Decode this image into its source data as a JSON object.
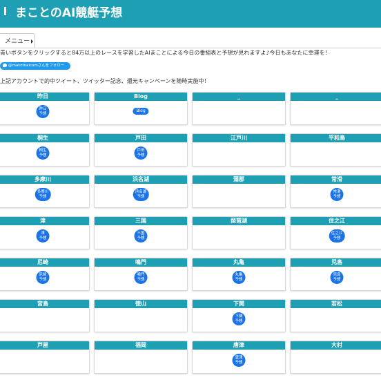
{
  "header": {
    "title": "まことのAI競艇予想"
  },
  "menu": {
    "label": "メニュー"
  },
  "intro_text": "青いボタンをクリックすると84万以上のレースを学習したAIまことによる今日の番組表と予想が見れますよ♪今日もあなたに幸運を！",
  "follow_button": "@makotoaicomさんをフォロー",
  "notice": "上記アカウントで的中ツイート、ツイッター記念、還元キャンペーンを随時実施中！",
  "cards": [
    {
      "name": "昨日",
      "button": [
        "昨日",
        "予想"
      ]
    },
    {
      "name": "Blog",
      "button": [
        "Blog"
      ],
      "wide": true
    },
    {
      "name": "_",
      "button": []
    },
    {
      "name": "_",
      "button": []
    },
    {
      "name": "桐生",
      "button": [
        "桐生",
        "予想"
      ]
    },
    {
      "name": "戸田",
      "button": [
        "戸田",
        "予想"
      ]
    },
    {
      "name": "江戸川",
      "button": []
    },
    {
      "name": "平和島",
      "button": []
    },
    {
      "name": "多摩川",
      "button": [
        "多摩川",
        "予想"
      ]
    },
    {
      "name": "浜名湖",
      "button": [
        "浜名湖",
        "予想"
      ]
    },
    {
      "name": "蒲郡",
      "button": []
    },
    {
      "name": "常滑",
      "button": [
        "常滑",
        "予想"
      ]
    },
    {
      "name": "津",
      "button": [
        "津",
        "予想"
      ]
    },
    {
      "name": "三国",
      "button": [
        "三国",
        "予想"
      ]
    },
    {
      "name": "琵琶湖",
      "button": []
    },
    {
      "name": "住之江",
      "button": [
        "住之江",
        "予想"
      ]
    },
    {
      "name": "尼崎",
      "button": [
        "尼崎",
        "予想"
      ]
    },
    {
      "name": "鳴門",
      "button": [
        "鳴門",
        "予想"
      ]
    },
    {
      "name": "丸亀",
      "button": [
        "丸亀",
        "予想"
      ]
    },
    {
      "name": "児島",
      "button": [
        "児島",
        "予想"
      ]
    },
    {
      "name": "宮島",
      "button": []
    },
    {
      "name": "徳山",
      "button": []
    },
    {
      "name": "下関",
      "button": [
        "下関",
        "予想"
      ]
    },
    {
      "name": "若松",
      "button": []
    },
    {
      "name": "芦屋",
      "button": []
    },
    {
      "name": "福岡",
      "button": []
    },
    {
      "name": "唐津",
      "button": [
        "唐津",
        "予想"
      ]
    },
    {
      "name": "大村",
      "button": []
    }
  ]
}
